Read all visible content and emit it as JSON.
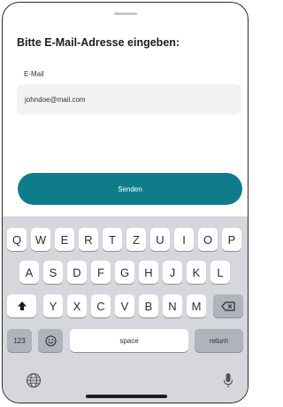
{
  "form": {
    "prompt": "Bitte E-Mail-Adresse eingeben:",
    "email_label": "E-Mail",
    "email_value": "johndoe@mail.com",
    "send_label": "Senden",
    "accent_color": "#0f7c8c"
  },
  "keyboard": {
    "row1": [
      "Q",
      "W",
      "E",
      "R",
      "T",
      "Z",
      "U",
      "I",
      "O",
      "P"
    ],
    "row2": [
      "A",
      "S",
      "D",
      "F",
      "G",
      "H",
      "J",
      "K",
      "L"
    ],
    "row3": [
      "Y",
      "X",
      "C",
      "V",
      "B",
      "N",
      "M"
    ],
    "numbers_label": "123",
    "space_label": "space",
    "return_label": "return",
    "icons": {
      "shift": "shift-arrow-icon",
      "delete": "backspace-icon",
      "emoji": "emoji-icon",
      "globe": "globe-icon",
      "mic": "microphone-icon"
    }
  }
}
